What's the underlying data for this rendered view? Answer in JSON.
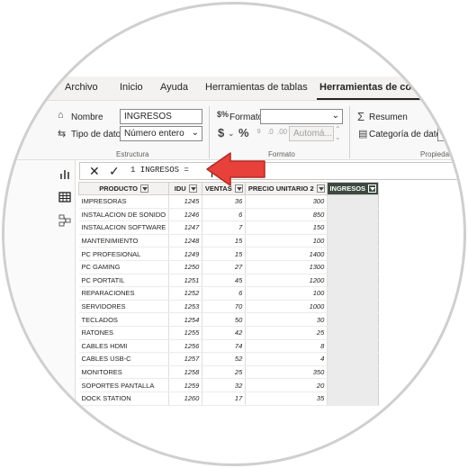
{
  "ribbon_tabs": [
    "Archivo",
    "Inicio",
    "Ayuda",
    "Herramientas de tablas",
    "Herramientas de colun"
  ],
  "structure": {
    "name_label": "Nombre",
    "name_value": "INGRESOS",
    "datatype_label": "Tipo de datos",
    "datatype_value": "Número entero",
    "group_label": "Estructura"
  },
  "format": {
    "format_label": "Formato",
    "format_value": "",
    "currency_symbol": "$",
    "percent_symbol": "%",
    "comma_symbol": "⁹",
    "decimals_value": "Automá...",
    "group_label": "Formato"
  },
  "properties": {
    "summary_label": "Resumen",
    "category_label": "Categoría de datos",
    "group_label": "Propiedad"
  },
  "formula_bar": {
    "cancel_glyph": "✕",
    "commit_glyph": "✓",
    "formula": "1  INGRESOS ="
  },
  "table": {
    "columns": [
      "PRODUCTO",
      "IDU",
      "VENTAS",
      "PRECIO UNITARIO 2",
      "INGRESOS"
    ],
    "rows": [
      [
        "IMPRESORAS",
        "1245",
        "36",
        "300"
      ],
      [
        "INSTALACION DE SONIDO",
        "1246",
        "6",
        "850"
      ],
      [
        "INSTALACION SOFTWARE",
        "1247",
        "7",
        "150"
      ],
      [
        "MANTENIMIENTO",
        "1248",
        "15",
        "100"
      ],
      [
        "PC PROFESIONAL",
        "1249",
        "15",
        "1400"
      ],
      [
        "PC GAMING",
        "1250",
        "27",
        "1300"
      ],
      [
        "PC PORTATIL",
        "1251",
        "45",
        "1200"
      ],
      [
        "REPARACIONES",
        "1252",
        "6",
        "100"
      ],
      [
        "SERVIDORES",
        "1253",
        "70",
        "1000"
      ],
      [
        "TECLADOS",
        "1254",
        "50",
        "30"
      ],
      [
        "RATONES",
        "1255",
        "42",
        "25"
      ],
      [
        "CABLES HDMI",
        "1256",
        "74",
        "8"
      ],
      [
        "CABLES USB-C",
        "1257",
        "52",
        "4"
      ],
      [
        "MONITORES",
        "1258",
        "25",
        "350"
      ],
      [
        "SOPORTES PANTALLA",
        "1259",
        "32",
        "20"
      ],
      [
        "DOCK STATION",
        "1260",
        "17",
        "35"
      ]
    ]
  },
  "colors": {
    "accent_arrow": "#e8403a",
    "selected_header": "#3d4a3f"
  }
}
